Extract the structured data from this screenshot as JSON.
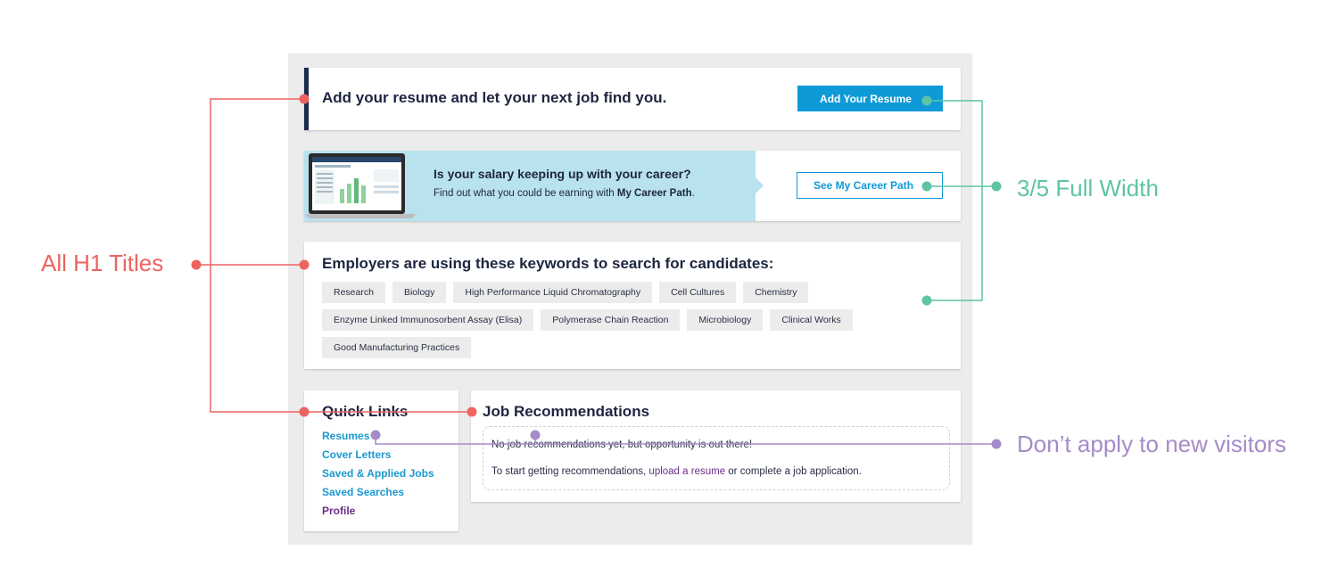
{
  "resume_card": {
    "title": "Add your resume and let your next job find you.",
    "button_label": "Add Your Resume"
  },
  "career_card": {
    "question": "Is your salary keeping up with your career?",
    "sub_prefix": "Find out what you could be earning with ",
    "sub_bold": "My Career Path",
    "sub_suffix": ".",
    "button_label": "See My Career Path"
  },
  "keywords_card": {
    "title": "Employers are using these keywords to search for candidates:",
    "keywords": [
      "Research",
      "Biology",
      "High Performance Liquid Chromatography",
      "Cell Cultures",
      "Chemistry",
      "Enzyme Linked Immunosorbent Assay (Elisa)",
      "Polymerase Chain Reaction",
      "Microbiology",
      "Clinical Works",
      "Good Manufacturing Practices"
    ]
  },
  "quick_links": {
    "title": "Quick Links",
    "items": [
      "Resumes",
      "Cover Letters",
      "Saved & Applied Jobs",
      "Saved Searches",
      "Profile"
    ]
  },
  "jobs": {
    "title": "Job Recommendations",
    "empty_message": "No job recommendations yet, but opportunity is out there!",
    "hint_prefix": "To start getting recommendations, ",
    "hint_link": "upload a resume",
    "hint_suffix": " or complete a job application."
  },
  "annotations": {
    "h1_titles": "All H1 Titles",
    "full_width": "3/5 Full Width",
    "new_visitors": "Don’t apply to new visitors"
  },
  "colors": {
    "primary_blue": "#0e9ad6",
    "navy": "#1b2a4a",
    "career_band": "#b8e2ee",
    "link_purple": "#6b2d8a",
    "annotation_red": "#ee6360",
    "annotation_teal": "#5ec4a4",
    "annotation_purple": "#a58bc9"
  }
}
